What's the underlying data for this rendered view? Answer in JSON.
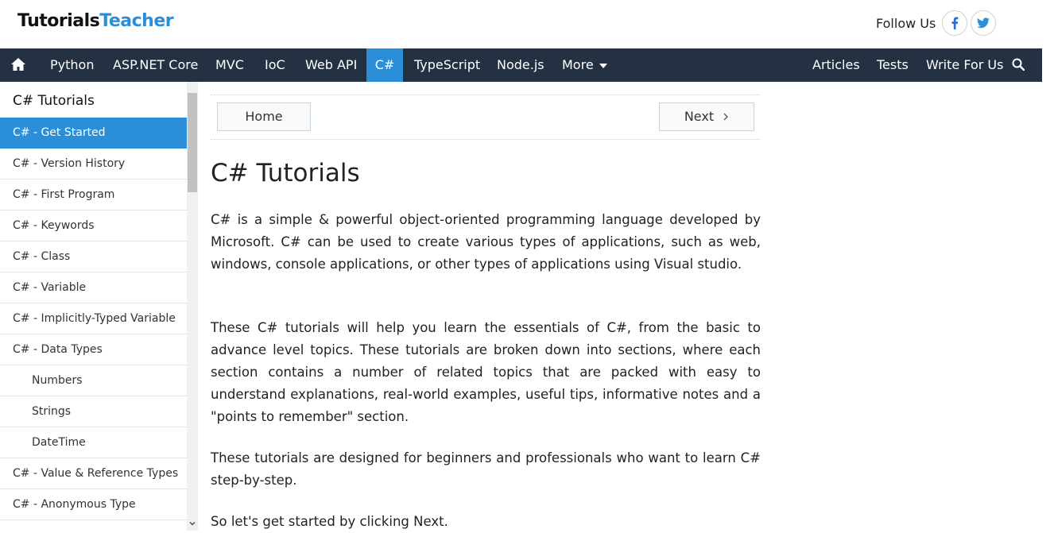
{
  "header": {
    "logo_part1": "Tutorials",
    "logo_part2": "Teacher",
    "follow_label": "Follow Us",
    "social_icons": [
      "facebook-icon",
      "twitter-icon"
    ]
  },
  "nav": {
    "items": [
      "Python",
      "ASP.NET Core",
      "MVC",
      "IoC",
      "Web API",
      "C#",
      "TypeScript",
      "Node.js",
      "More"
    ],
    "active": "C#",
    "right_items": [
      "Articles",
      "Tests",
      "Write For Us"
    ],
    "colors": {
      "bar": "#233143",
      "accent": "#2a8fd8"
    }
  },
  "sidebar": {
    "title": "C# Tutorials",
    "items": [
      {
        "label": "C# - Get Started",
        "active": true
      },
      {
        "label": "C# - Version History"
      },
      {
        "label": "C# - First Program"
      },
      {
        "label": "C# - Keywords"
      },
      {
        "label": "C# - Class"
      },
      {
        "label": "C# - Variable"
      },
      {
        "label": "C# - Implicitly-Typed Variable"
      },
      {
        "label": "C# - Data Types"
      },
      {
        "label": "Numbers",
        "sub": true
      },
      {
        "label": "Strings",
        "sub": true
      },
      {
        "label": "DateTime",
        "sub": true
      },
      {
        "label": "C# - Value & Reference Types"
      },
      {
        "label": "C# - Anonymous Type"
      }
    ]
  },
  "pager": {
    "home_label": "Home",
    "next_label": "Next"
  },
  "main": {
    "title": "C# Tutorials",
    "paragraphs": [
      "C# is a simple & powerful object-oriented programming language developed by Microsoft. C# can be used to create various types of applications, such as web, windows, console applications, or other types of applications using Visual studio.",
      "These C# tutorials will help you learn the essentials of C#, from the basic to advance level topics. These tutorials are broken down into sections, where each section contains a number of related topics that are packed with easy to understand explanations, real-world examples, useful tips, informative notes and a \"points to remember\" section.",
      "These tutorials are designed for beginners and professionals who want to learn C# step-by-step.",
      "So let's get started by clicking Next."
    ]
  }
}
